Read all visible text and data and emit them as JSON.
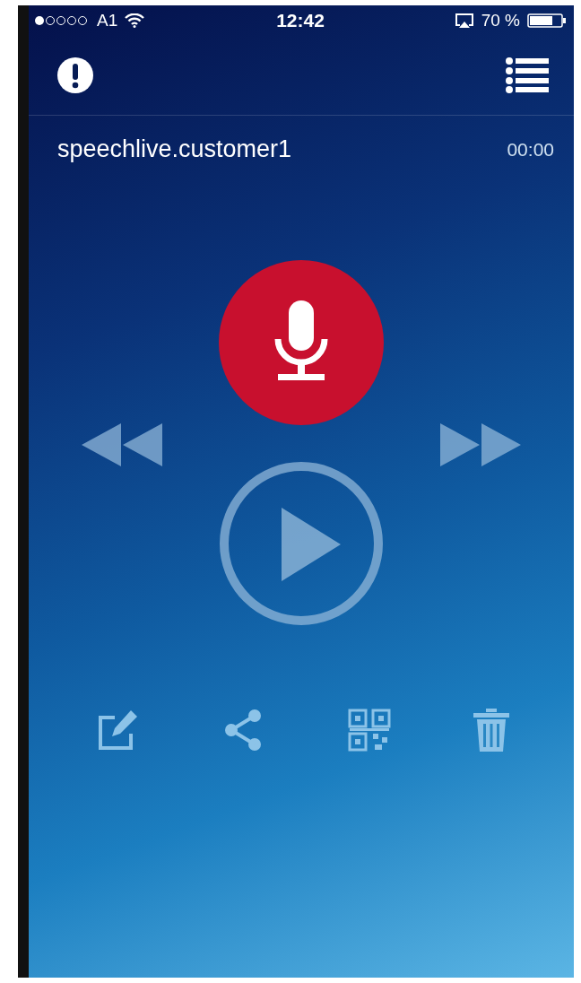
{
  "status_bar": {
    "carrier": "A1",
    "time": "12:42",
    "battery": "70 %"
  },
  "recording": {
    "account": "speechlive.customer1",
    "duration": "00:00"
  }
}
